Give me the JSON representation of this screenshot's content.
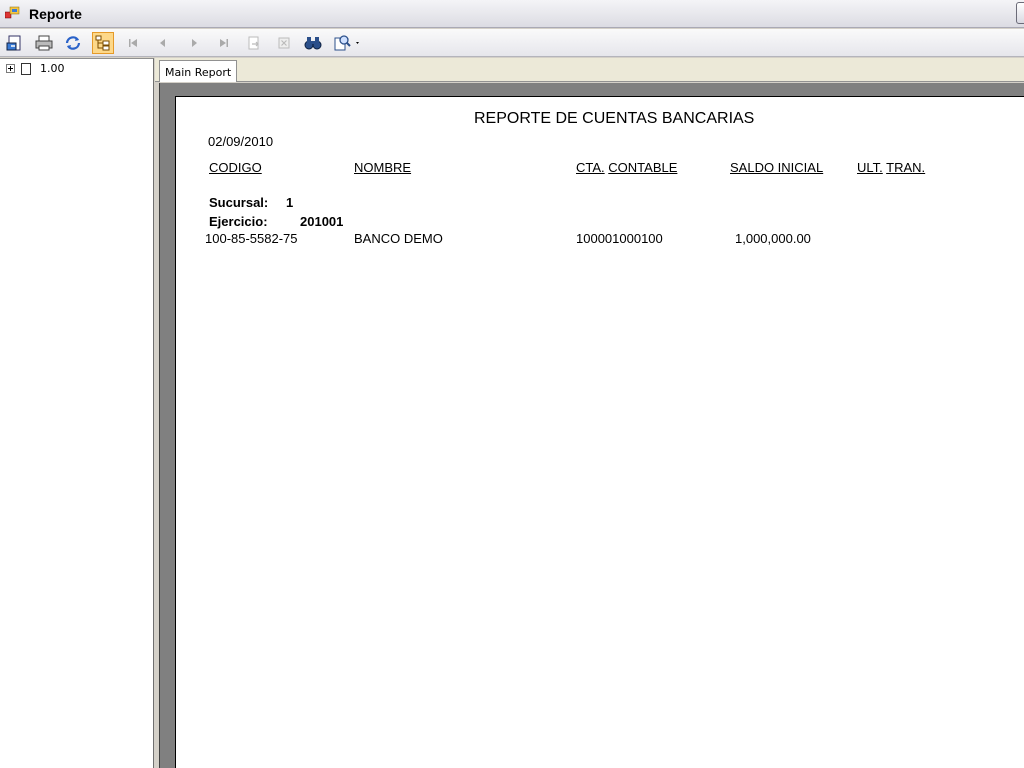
{
  "window": {
    "title": "Reporte"
  },
  "toolbar": {
    "buttons": [
      {
        "name": "export-icon"
      },
      {
        "name": "print-icon"
      },
      {
        "name": "refresh-icon"
      },
      {
        "name": "group-tree-toggle-icon",
        "active": true
      },
      {
        "name": "first-page-icon"
      },
      {
        "name": "previous-page-icon"
      },
      {
        "name": "next-page-icon"
      },
      {
        "name": "last-page-icon"
      },
      {
        "name": "goto-page-icon"
      },
      {
        "name": "stop-icon"
      },
      {
        "name": "find-icon"
      },
      {
        "name": "zoom-icon"
      }
    ]
  },
  "tree": {
    "node_label": "1.00"
  },
  "tabs": {
    "main": "Main Report"
  },
  "report": {
    "title": "REPORTE DE CUENTAS BANCARIAS",
    "date": "02/09/2010",
    "headers": {
      "codigo": "CODIGO",
      "nombre": "NOMBRE",
      "cta_contable_1": "CTA.",
      "cta_contable_2": "CONTABLE",
      "saldo_inicial": "SALDO INICIAL",
      "ult_tran_1": "ULT.",
      "ult_tran_2": "TRAN."
    },
    "group": {
      "sucursal_label": "Sucursal:",
      "sucursal_value": "1",
      "ejercicio_label": "Ejercicio:",
      "ejercicio_value": "201001"
    },
    "rows": [
      {
        "codigo": "100-85-5582-75",
        "nombre": "BANCO DEMO",
        "cta_contable": "100001000100",
        "saldo_inicial": "1,000,000.00"
      }
    ]
  },
  "colors": {
    "active_button": "#fdd889",
    "report_background": "#808080"
  }
}
